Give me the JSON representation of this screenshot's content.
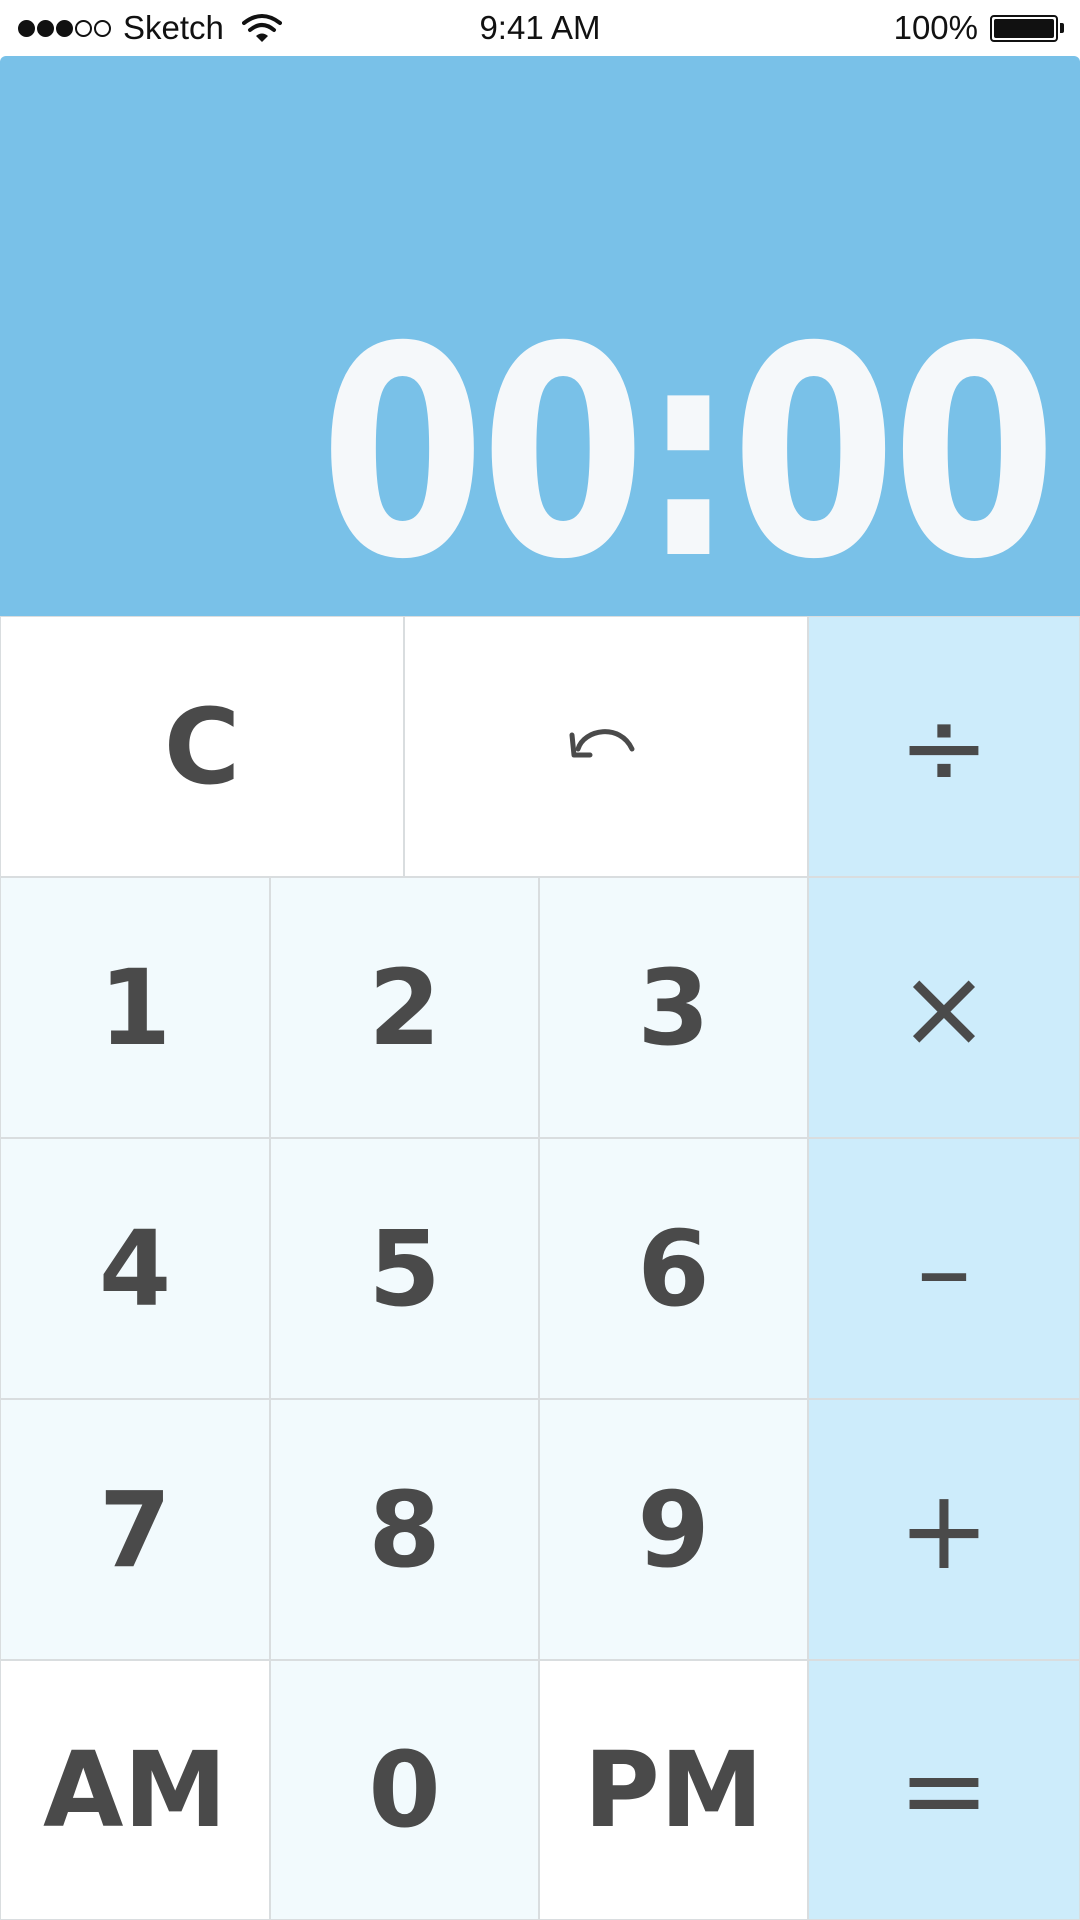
{
  "status_bar": {
    "carrier": "Sketch",
    "signal_bars_filled": 3,
    "signal_bars_total": 5,
    "time": "9:41 AM",
    "battery": "100%"
  },
  "display": {
    "value": "00:00",
    "background_color": "#79c1e8"
  },
  "keypad": {
    "clear_label": "C",
    "undo_icon": "undo-icon",
    "divide_label": "÷",
    "multiply_label": "×",
    "minus_label": "–",
    "plus_label": "+",
    "equals_label": "=",
    "digit_1": "1",
    "digit_2": "2",
    "digit_3": "3",
    "digit_4": "4",
    "digit_5": "5",
    "digit_6": "6",
    "digit_7": "7",
    "digit_8": "8",
    "digit_9": "9",
    "digit_0": "0",
    "am_label": "AM",
    "pm_label": "PM",
    "colors": {
      "function_key": "#ffffff",
      "digit_key": "#f2fafd",
      "operator_key": "#cdecfb",
      "key_text": "#4a4a4a"
    }
  }
}
